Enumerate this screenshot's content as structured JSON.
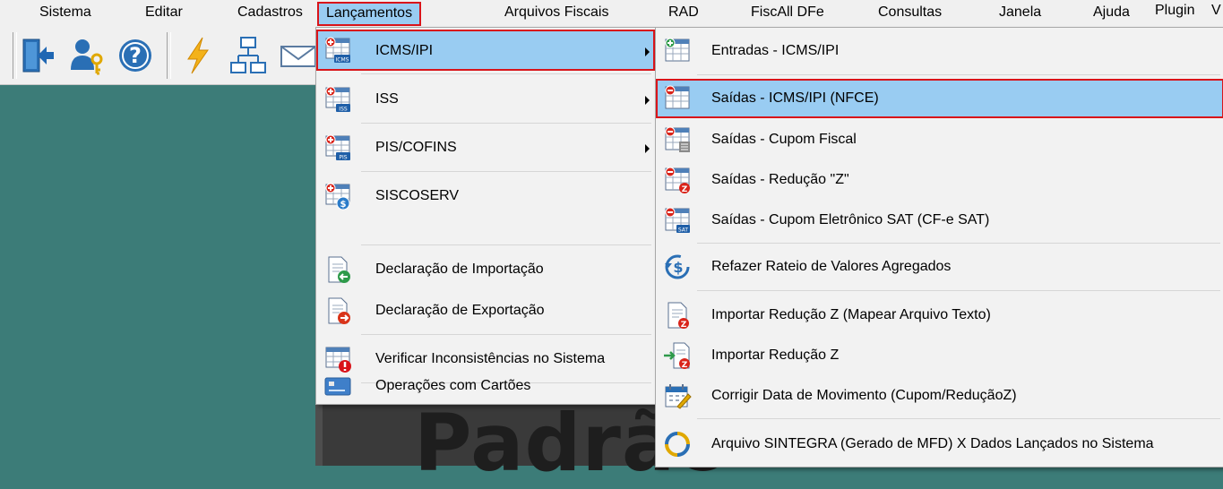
{
  "menubar": {
    "items": [
      "Sistema",
      "Editar",
      "Cadastros",
      "Lançamentos",
      "Arquivos Fiscais",
      "RAD",
      "FiscAll DFe",
      "Consultas",
      "Janela",
      "Ajuda",
      "Plugin",
      "V"
    ]
  },
  "toolbar": {
    "buttons": [
      "exit-icon",
      "user-key-icon",
      "help-icon",
      "lightning-icon",
      "network-icon",
      "mail-icon"
    ]
  },
  "background": {
    "doc_text": "Padrão"
  },
  "menu_lancamentos": {
    "items": [
      {
        "label": "ICMS/IPI",
        "icon": "icms-ipi-icon",
        "submenu": true,
        "highlighted": true
      },
      {
        "label": "ISS",
        "icon": "iss-icon",
        "submenu": true
      },
      {
        "label": "PIS/COFINS",
        "icon": "pis-cofins-icon",
        "submenu": true
      },
      {
        "label": "SISCOSERV",
        "icon": "siscoserv-icon"
      },
      {
        "label": "Declaração de Importação",
        "icon": "import-doc-icon"
      },
      {
        "label": "Declaração de Exportação",
        "icon": "export-doc-icon"
      },
      {
        "label": "Verificar Inconsistências no Sistema",
        "icon": "warning-doc-icon"
      },
      {
        "label": "Operações com Cartões",
        "icon": "card-icon"
      }
    ]
  },
  "menu_icms_ipi": {
    "items": [
      {
        "label": "Entradas - ICMS/IPI",
        "icon": "entries-icon"
      },
      {
        "label": "Saídas - ICMS/IPI (NFCE)",
        "icon": "exits-nfce-icon",
        "highlighted": true
      },
      {
        "label": "Saídas - Cupom Fiscal",
        "icon": "exits-cupom-icon"
      },
      {
        "label": "Saídas - Redução \"Z\"",
        "icon": "exits-reducao-z-icon"
      },
      {
        "label": "Saídas - Cupom Eletrônico SAT (CF-e SAT)",
        "icon": "exits-sat-icon"
      },
      {
        "label": "Refazer Rateio de Valores Agregados",
        "icon": "refresh-money-icon"
      },
      {
        "label": "Importar Redução Z (Mapear Arquivo Texto)",
        "icon": "import-text-z-icon"
      },
      {
        "label": "Importar Redução Z",
        "icon": "import-z-icon"
      },
      {
        "label": "Corrigir Data de Movimento (Cupom/ReduçãoZ)",
        "icon": "calendar-edit-icon"
      },
      {
        "label": "Arquivo SINTEGRA (Gerado de MFD) X Dados Lançados no Sistema",
        "icon": "sintegra-icon"
      }
    ]
  },
  "colors": {
    "highlight": "#99ccf2",
    "annotation": "#d9141a",
    "desktop": "#3c7c78"
  }
}
